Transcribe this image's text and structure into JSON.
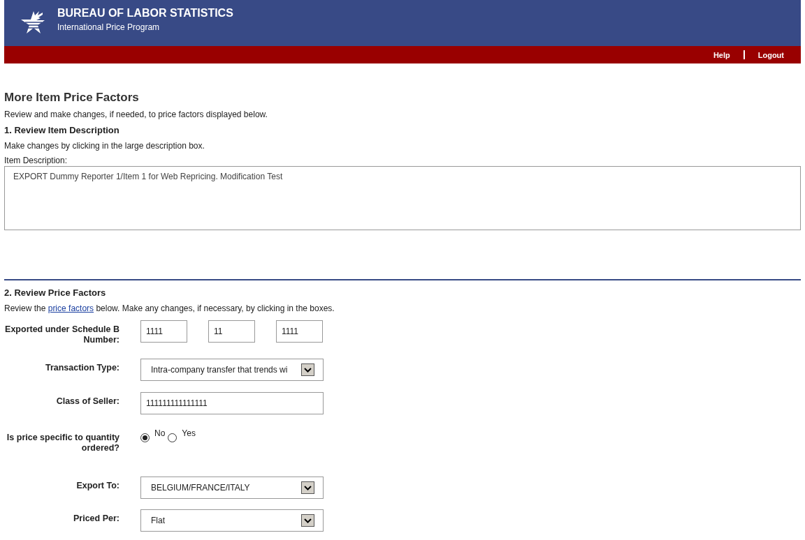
{
  "header": {
    "title": "BUREAU OF LABOR STATISTICS",
    "subtitle": "International Price Program"
  },
  "nav": [
    "Help",
    "Logout"
  ],
  "page_title": "More Item Price Factors",
  "intro": "Review and make changes, if needed, to price factors displayed below.",
  "section1": {
    "heading": "1. Review Item Description",
    "note": "Make changes by clicking in the large description box.",
    "field_label": "Item Description:",
    "value": "EXPORT Dummy Reporter 1/Item 1 for Web Repricing. Modification Test"
  },
  "section2": {
    "heading": "2. Review Price Factors",
    "note_before": "Review the ",
    "link": "price factors",
    "note_after": " below. Make any changes, if necessary, by clicking in the boxes.",
    "fields": [
      {
        "kind": "inputs",
        "label": "Exported under Schedule B Number:",
        "values": [
          "1111",
          "11",
          "1111"
        ]
      },
      {
        "kind": "select",
        "label": "Transaction Type:",
        "value": "Intra-company transfer that trends wi"
      },
      {
        "kind": "input",
        "label": "Class of Seller:",
        "value": "111111111111111"
      },
      {
        "kind": "radio",
        "label": "Is price specific to quantity ordered?",
        "options": [
          {
            "label": "No",
            "selected": true
          },
          {
            "label": "Yes",
            "selected": false
          }
        ]
      },
      {
        "kind": "select",
        "label": "Export To:",
        "value": "BELGIUM/FRANCE/ITALY"
      },
      {
        "kind": "select",
        "label": "Priced Per:",
        "value": "Flat"
      }
    ]
  }
}
